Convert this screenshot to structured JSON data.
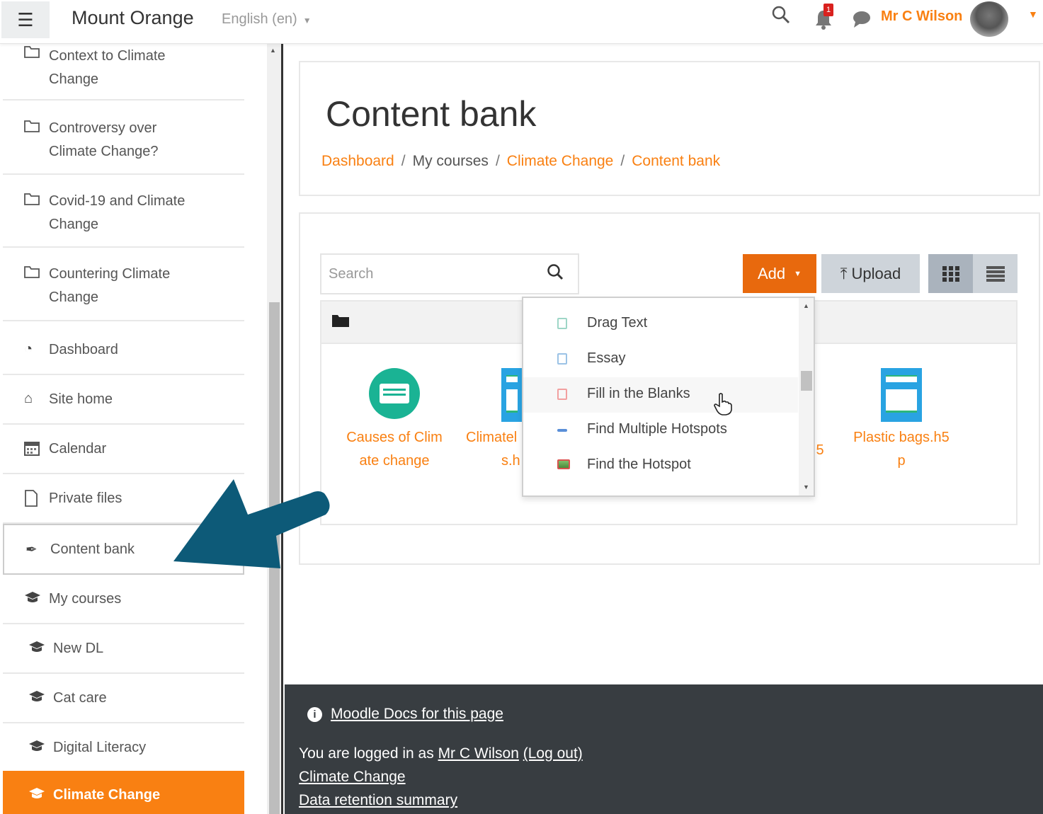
{
  "navbar": {
    "site_name": "Mount Orange",
    "language": "English (en)",
    "notification_count": "1",
    "user_name": "Mr C Wilson"
  },
  "sidebar": {
    "items": [
      {
        "label": "Context to Climate Change",
        "icon": "folder-icon"
      },
      {
        "label": "Controversy over Climate Change?",
        "icon": "folder-icon"
      },
      {
        "label": "Covid-19 and Climate Change",
        "icon": "folder-icon"
      },
      {
        "label": "Countering Climate Change",
        "icon": "folder-icon"
      },
      {
        "label": "Dashboard",
        "icon": "dashboard-icon"
      },
      {
        "label": "Site home",
        "icon": "home-icon"
      },
      {
        "label": "Calendar",
        "icon": "calendar-icon"
      },
      {
        "label": "Private files",
        "icon": "file-icon"
      },
      {
        "label": "Content bank",
        "icon": "brush-icon"
      },
      {
        "label": "My courses",
        "icon": "graduation-cap-icon"
      },
      {
        "label": "New DL",
        "icon": "graduation-cap-icon"
      },
      {
        "label": "Cat care",
        "icon": "graduation-cap-icon"
      },
      {
        "label": "Digital Literacy",
        "icon": "graduation-cap-icon"
      },
      {
        "label": "Climate Change",
        "icon": "graduation-cap-icon"
      }
    ]
  },
  "page": {
    "title": "Content bank",
    "breadcrumb": [
      "Dashboard",
      "My courses",
      "Climate Change",
      "Content bank"
    ]
  },
  "toolbar": {
    "search_placeholder": "Search",
    "add_label": "Add",
    "upload_label": "Upload"
  },
  "files": [
    {
      "name_line1": "Causes of Clim",
      "name_line2": "ate change",
      "icon": "h5p-round-icon"
    },
    {
      "name_line1": "Climatel",
      "name_line2": "s.h",
      "icon": "h5p-doc-icon"
    },
    {
      "name_line1": "5",
      "name_line2": "",
      "icon": ""
    },
    {
      "name_line1": "Plastic bags.h5",
      "name_line2": "p",
      "icon": "h5p-doc-icon"
    }
  ],
  "add_menu": {
    "items": [
      "Drag Text",
      "Essay",
      "Fill in the Blanks",
      "Find Multiple Hotspots",
      "Find the Hotspot"
    ]
  },
  "footer": {
    "docs_link": "Moodle Docs for this page",
    "logged_prefix": "You are logged in as",
    "user_link": "Mr C Wilson",
    "logout_link": "(Log out)",
    "course_link": "Climate Change",
    "retention_link": "Data retention summary"
  },
  "colors": {
    "accent": "#f98012",
    "add_button": "#e8690d",
    "footer_bg": "#383d41",
    "arrow": "#0d5a78"
  }
}
